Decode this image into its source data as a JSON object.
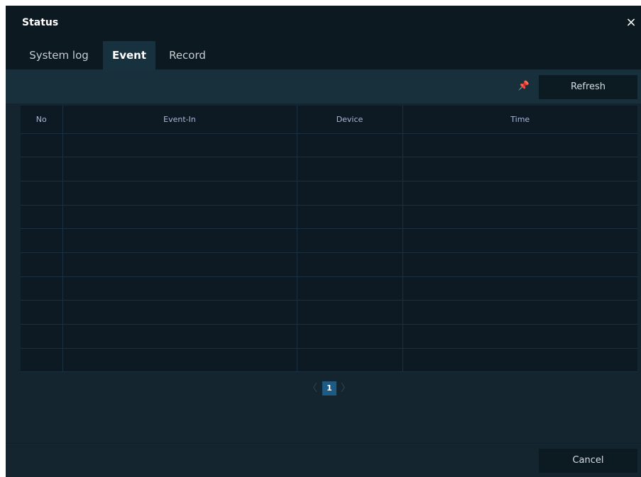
{
  "dialog": {
    "title": "Status",
    "close_icon": "×"
  },
  "tabs": [
    {
      "label": "System log",
      "active": false
    },
    {
      "label": "Event",
      "active": true
    },
    {
      "label": "Record",
      "active": false
    }
  ],
  "toolbar": {
    "pin_icon": "pushpin-icon",
    "refresh_label": "Refresh"
  },
  "table": {
    "columns": [
      "No",
      "Event-In",
      "Device",
      "Time"
    ],
    "rows": []
  },
  "pager": {
    "prev_icon": "〈",
    "current_page": "1",
    "next_icon": "〉"
  },
  "footer": {
    "cancel_label": "Cancel"
  },
  "colors": {
    "background": "#14252f",
    "header": "#0c1920",
    "table_bg": "#0d1a23",
    "active_tab": "#18313e",
    "page_highlight": "#1d5a84"
  }
}
